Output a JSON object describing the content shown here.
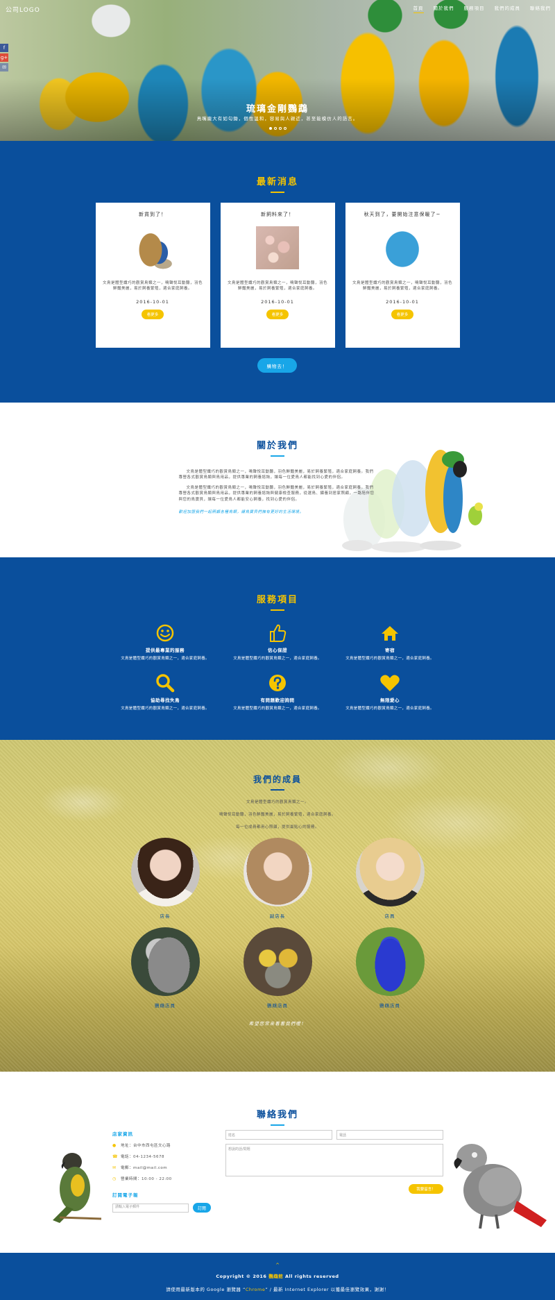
{
  "header": {
    "logo": "公司LOGO",
    "nav": [
      "首頁",
      "關於我們",
      "服務項目",
      "我們的成員",
      "聯絡我們"
    ],
    "social": [
      "f",
      "g+",
      "✉"
    ]
  },
  "hero": {
    "title": "琉璃金剛鸚鵡",
    "subtitle": "鳥嘴龐大有如勾鋤，個性溫和，容易與人親近，甚至能模仿人的語言。",
    "slides": 4,
    "active_slide": 1
  },
  "news": {
    "title": "最新消息",
    "cards": [
      {
        "title": "新貨到了！",
        "text": "文鳥是體型纖巧的觀賞鳥類之一，鳴聲悅耳動聽，羽色鮮豔美麗，易於飼養繁殖，適合家庭飼養。",
        "date": "2016-10-01",
        "button": "看更多"
      },
      {
        "title": "新飼料來了！",
        "text": "文鳥是體型纖巧的觀賞鳥類之一，鳴聲悅耳動聽，羽色鮮豔美麗，易於飼養繁殖，適合家庭飼養。",
        "date": "2016-10-01",
        "button": "看更多"
      },
      {
        "title": "秋天到了，要開始注意保暖了~",
        "text": "文鳥是體型纖巧的觀賞鳥類之一，鳴聲悅耳動聽，羽色鮮豔美麗，易於飼養繁殖，適合家庭飼養。",
        "date": "2016-10-01",
        "button": "看更多"
      }
    ],
    "more_button": "購物去！"
  },
  "about": {
    "title": "關於我們",
    "paragraphs": [
      "文鳥是體型纖巧的觀賞鳥類之一，鳴聲悅耳動聽，羽色鮮豔美麗，易於飼養繁殖，適合家庭飼養。我們專營各式觀賞鳥類與鳥用品，提供專業的飼養諮詢，讓每一位愛鳥人都能找到心愛的伴侶。",
      "文鳥是體型纖巧的觀賞鳥類之一，鳴聲悅耳動聽，羽色鮮豔美麗，易於飼養繁殖，適合家庭飼養。我們專營各式觀賞鳥類與鳥用品，提供專業的飼養諮詢與健康檢查服務，從選鳥、餵養到居家照顧，一路陪伴您與您的鳥寶貝，讓每一位愛鳥人都能安心飼養，找到心愛的伴侶。"
    ],
    "note": "歡迎加盟我們一起照顧各種鳥類，讓鳥寶貝們擁有更好的生活環境。"
  },
  "services": {
    "title": "服務項目",
    "items": [
      {
        "icon": "smile-icon",
        "title": "提供最專業的服務",
        "desc": "文鳥是體型纖巧的觀賞鳥類之一，適合家庭飼養。"
      },
      {
        "icon": "thumbs-up-icon",
        "title": "信心保證",
        "desc": "文鳥是體型纖巧的觀賞鳥類之一，適合家庭飼養。"
      },
      {
        "icon": "home-icon",
        "title": "寄宿",
        "desc": "文鳥是體型纖巧的觀賞鳥類之一，適合家庭飼養。"
      },
      {
        "icon": "search-icon",
        "title": "協助尋找失鳥",
        "desc": "文鳥是體型纖巧的觀賞鳥類之一，適合家庭飼養。"
      },
      {
        "icon": "question-icon",
        "title": "有問題歡迎詢問",
        "desc": "文鳥是體型纖巧的觀賞鳥類之一，適合家庭飼養。"
      },
      {
        "icon": "heart-icon",
        "title": "無限愛心",
        "desc": "文鳥是體型纖巧的觀賞鳥類之一，適合家庭飼養。"
      }
    ]
  },
  "members": {
    "title": "我們的成員",
    "lines": [
      "文鳥是體型纖巧的觀賞鳥類之一。",
      "鳴聲悅耳動聽，羽色鮮豔美麗，易於飼養繁殖，適合家庭飼養。",
      "每一位成員都用心照顧，提供最貼心的服務。"
    ],
    "people": [
      {
        "name": "店長"
      },
      {
        "name": "副店長"
      },
      {
        "name": "店員"
      },
      {
        "name": "鸚鵡店員"
      },
      {
        "name": "鸚鵡店員"
      },
      {
        "name": "鸚鵡店員"
      }
    ],
    "note": "希望您常來看看我們喔！"
  },
  "contact": {
    "title": "聯絡我們",
    "info_heading": "店家資訊",
    "address": "地址：台中市西屯區文心路",
    "phone": "電話：04-1234-5678",
    "email": "電郵：mail@mail.com",
    "hours": "營業時間：10:00 - 22:00",
    "subscribe_heading": "訂閱電子報",
    "subscribe_placeholder": "請輸入電子郵件",
    "subscribe_button": "訂閱",
    "form": {
      "name_placeholder": "姓名",
      "phone_placeholder": "電話",
      "message_placeholder": "想說的話/問題",
      "send_button": "我要留言！"
    }
  },
  "footer": {
    "arrow": "^",
    "copy_prefix": "Copyright © 2016 ",
    "copy_brand": "鸚鵡館",
    "copy_suffix": " All rights reserved",
    "browser_prefix": "請使用最新版本的 Google 瀏覽器 “",
    "browser_brand": "Chrome",
    "browser_suffix": "” / 最新 Internet Explorer 以獲最佳瀏覽效果，謝謝！"
  },
  "colors": {
    "primary_blue": "#0a4f9c",
    "accent_yellow": "#f5c400",
    "accent_cyan": "#18a6e8"
  }
}
